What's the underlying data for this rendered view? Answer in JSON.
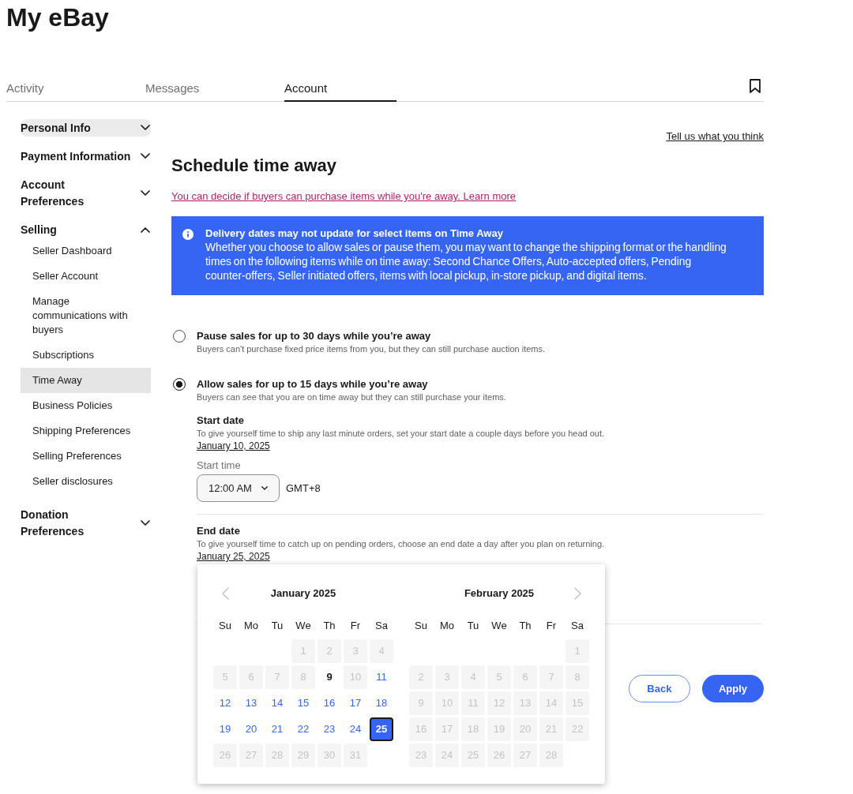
{
  "page_title": "My eBay",
  "tabs": [
    {
      "label": "Activity",
      "selected": false
    },
    {
      "label": "Messages",
      "selected": false
    },
    {
      "label": "Account",
      "selected": true
    }
  ],
  "sidebar": {
    "sections": [
      {
        "label": "Personal Info",
        "expanded": false,
        "highlighted": true
      },
      {
        "label": "Payment Information",
        "expanded": false,
        "highlighted": false
      },
      {
        "label": "Account Preferences",
        "expanded": false,
        "highlighted": false
      },
      {
        "label": "Selling",
        "expanded": true,
        "highlighted": false,
        "children": [
          {
            "label": "Seller Dashboard",
            "selected": false
          },
          {
            "label": "Seller Account",
            "selected": false
          },
          {
            "label": "Manage communications with buyers",
            "selected": false
          },
          {
            "label": "Subscriptions",
            "selected": false
          },
          {
            "label": "Time Away",
            "selected": true
          },
          {
            "label": "Business Policies",
            "selected": false
          },
          {
            "label": "Shipping Preferences",
            "selected": false
          },
          {
            "label": "Selling Preferences",
            "selected": false
          },
          {
            "label": "Seller disclosures",
            "selected": false
          }
        ]
      },
      {
        "label": "Donation Preferences",
        "expanded": false,
        "highlighted": false
      }
    ]
  },
  "feedback_link": "Tell us what you think",
  "heading": "Schedule time away",
  "intro_link": "You can decide if buyers can purchase items while you're away. Learn more",
  "notice": {
    "title": "Delivery dates may not update for select items on Time Away",
    "body": "Whether you choose to allow sales or pause them, you may want to change the shipping format or the handling times on the following items while on time away: Second Chance Offers, Auto-accepted offers, Pending counter-offers, Seller initiated offers, items with local pickup, in-store pickup, and digital items."
  },
  "options": [
    {
      "title": "Pause sales for up to 30 days while you’re away",
      "description": "Buyers can't purchase fixed price items from you, but they can still purchase auction items.",
      "selected": false
    },
    {
      "title": "Allow sales for up to 15 days while you’re away",
      "description": "Buyers can see that you are on time away but they can still purchase your items.",
      "selected": true
    }
  ],
  "schedule": {
    "start_date": {
      "label": "Start date",
      "hint": "To give yourself time to ship any last minute orders, set your start date a couple days before you head out.",
      "value": "January 10, 2025"
    },
    "start_time": {
      "label": "Start time",
      "value": "12:00 AM",
      "timezone": "GMT+8"
    },
    "end_date": {
      "label": "End date",
      "hint": "To give yourself time to catch up on pending orders, choose an end date a day after you plan on returning.",
      "value": "January 25, 2025"
    }
  },
  "date_picker": {
    "months": [
      {
        "title": "January 2025",
        "weekdays": [
          "Su",
          "Mo",
          "Tu",
          "We",
          "Th",
          "Fr",
          "Sa"
        ],
        "days": [
          {
            "kind": "empty"
          },
          {
            "kind": "empty"
          },
          {
            "kind": "empty"
          },
          {
            "kind": "date",
            "label": "1",
            "disabled": true,
            "today": false,
            "selected": false
          },
          {
            "kind": "date",
            "label": "2",
            "disabled": true,
            "today": false,
            "selected": false
          },
          {
            "kind": "date",
            "label": "3",
            "disabled": true,
            "today": false,
            "selected": false
          },
          {
            "kind": "date",
            "label": "4",
            "disabled": true,
            "today": false,
            "selected": false
          },
          {
            "kind": "date",
            "label": "5",
            "disabled": true,
            "today": false,
            "selected": false
          },
          {
            "kind": "date",
            "label": "6",
            "disabled": true,
            "today": false,
            "selected": false
          },
          {
            "kind": "date",
            "label": "7",
            "disabled": true,
            "today": false,
            "selected": false
          },
          {
            "kind": "date",
            "label": "8",
            "disabled": true,
            "today": false,
            "selected": false
          },
          {
            "kind": "date",
            "label": "9",
            "disabled": false,
            "today": true,
            "selected": false
          },
          {
            "kind": "date",
            "label": "10",
            "disabled": true,
            "today": false,
            "selected": false
          },
          {
            "kind": "date",
            "label": "11",
            "disabled": false,
            "today": false,
            "selected": false
          },
          {
            "kind": "date",
            "label": "12",
            "disabled": false,
            "today": false,
            "selected": false
          },
          {
            "kind": "date",
            "label": "13",
            "disabled": false,
            "today": false,
            "selected": false
          },
          {
            "kind": "date",
            "label": "14",
            "disabled": false,
            "today": false,
            "selected": false
          },
          {
            "kind": "date",
            "label": "15",
            "disabled": false,
            "today": false,
            "selected": false
          },
          {
            "kind": "date",
            "label": "16",
            "disabled": false,
            "today": false,
            "selected": false
          },
          {
            "kind": "date",
            "label": "17",
            "disabled": false,
            "today": false,
            "selected": false
          },
          {
            "kind": "date",
            "label": "18",
            "disabled": false,
            "today": false,
            "selected": false
          },
          {
            "kind": "date",
            "label": "19",
            "disabled": false,
            "today": false,
            "selected": false
          },
          {
            "kind": "date",
            "label": "20",
            "disabled": false,
            "today": false,
            "selected": false
          },
          {
            "kind": "date",
            "label": "21",
            "disabled": false,
            "today": false,
            "selected": false
          },
          {
            "kind": "date",
            "label": "22",
            "disabled": false,
            "today": false,
            "selected": false
          },
          {
            "kind": "date",
            "label": "23",
            "disabled": false,
            "today": false,
            "selected": false
          },
          {
            "kind": "date",
            "label": "24",
            "disabled": false,
            "today": false,
            "selected": false
          },
          {
            "kind": "date",
            "label": "25",
            "disabled": false,
            "today": false,
            "selected": true
          },
          {
            "kind": "date",
            "label": "26",
            "disabled": true,
            "today": false,
            "selected": false
          },
          {
            "kind": "date",
            "label": "27",
            "disabled": true,
            "today": false,
            "selected": false
          },
          {
            "kind": "date",
            "label": "28",
            "disabled": true,
            "today": false,
            "selected": false
          },
          {
            "kind": "date",
            "label": "29",
            "disabled": true,
            "today": false,
            "selected": false
          },
          {
            "kind": "date",
            "label": "30",
            "disabled": true,
            "today": false,
            "selected": false
          },
          {
            "kind": "date",
            "label": "31",
            "disabled": true,
            "today": false,
            "selected": false
          }
        ]
      },
      {
        "title": "February 2025",
        "weekdays": [
          "Su",
          "Mo",
          "Tu",
          "We",
          "Th",
          "Fr",
          "Sa"
        ],
        "days": [
          {
            "kind": "empty"
          },
          {
            "kind": "empty"
          },
          {
            "kind": "empty"
          },
          {
            "kind": "empty"
          },
          {
            "kind": "empty"
          },
          {
            "kind": "empty"
          },
          {
            "kind": "date",
            "label": "1",
            "disabled": true,
            "today": false,
            "selected": false
          },
          {
            "kind": "date",
            "label": "2",
            "disabled": true,
            "today": false,
            "selected": false
          },
          {
            "kind": "date",
            "label": "3",
            "disabled": true,
            "today": false,
            "selected": false
          },
          {
            "kind": "date",
            "label": "4",
            "disabled": true,
            "today": false,
            "selected": false
          },
          {
            "kind": "date",
            "label": "5",
            "disabled": true,
            "today": false,
            "selected": false
          },
          {
            "kind": "date",
            "label": "6",
            "disabled": true,
            "today": false,
            "selected": false
          },
          {
            "kind": "date",
            "label": "7",
            "disabled": true,
            "today": false,
            "selected": false
          },
          {
            "kind": "date",
            "label": "8",
            "disabled": true,
            "today": false,
            "selected": false
          },
          {
            "kind": "date",
            "label": "9",
            "disabled": true,
            "today": false,
            "selected": false
          },
          {
            "kind": "date",
            "label": "10",
            "disabled": true,
            "today": false,
            "selected": false
          },
          {
            "kind": "date",
            "label": "11",
            "disabled": true,
            "today": false,
            "selected": false
          },
          {
            "kind": "date",
            "label": "12",
            "disabled": true,
            "today": false,
            "selected": false
          },
          {
            "kind": "date",
            "label": "13",
            "disabled": true,
            "today": false,
            "selected": false
          },
          {
            "kind": "date",
            "label": "14",
            "disabled": true,
            "today": false,
            "selected": false
          },
          {
            "kind": "date",
            "label": "15",
            "disabled": true,
            "today": false,
            "selected": false
          },
          {
            "kind": "date",
            "label": "16",
            "disabled": true,
            "today": false,
            "selected": false
          },
          {
            "kind": "date",
            "label": "17",
            "disabled": true,
            "today": false,
            "selected": false
          },
          {
            "kind": "date",
            "label": "18",
            "disabled": true,
            "today": false,
            "selected": false
          },
          {
            "kind": "date",
            "label": "19",
            "disabled": true,
            "today": false,
            "selected": false
          },
          {
            "kind": "date",
            "label": "20",
            "disabled": true,
            "today": false,
            "selected": false
          },
          {
            "kind": "date",
            "label": "21",
            "disabled": true,
            "today": false,
            "selected": false
          },
          {
            "kind": "date",
            "label": "22",
            "disabled": true,
            "today": false,
            "selected": false
          },
          {
            "kind": "date",
            "label": "23",
            "disabled": true,
            "today": false,
            "selected": false
          },
          {
            "kind": "date",
            "label": "24",
            "disabled": true,
            "today": false,
            "selected": false
          },
          {
            "kind": "date",
            "label": "25",
            "disabled": true,
            "today": false,
            "selected": false
          },
          {
            "kind": "date",
            "label": "26",
            "disabled": true,
            "today": false,
            "selected": false
          },
          {
            "kind": "date",
            "label": "27",
            "disabled": true,
            "today": false,
            "selected": false
          },
          {
            "kind": "date",
            "label": "28",
            "disabled": true,
            "today": false,
            "selected": false
          }
        ]
      }
    ]
  },
  "buttons": [
    {
      "label": "Back",
      "kind": "secondary"
    },
    {
      "label": "Apply",
      "kind": "primary"
    }
  ]
}
